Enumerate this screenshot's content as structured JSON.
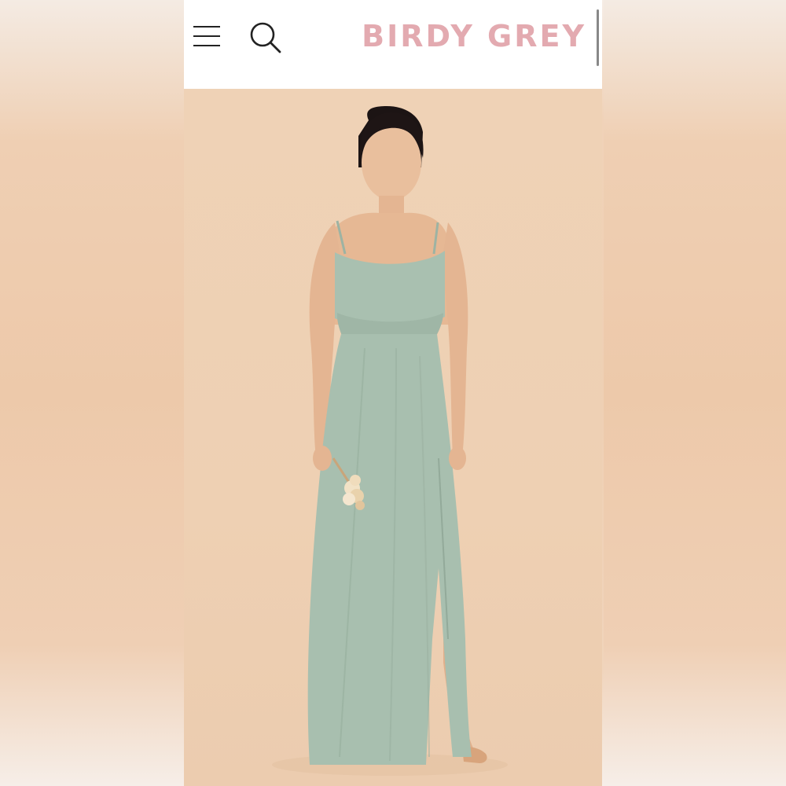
{
  "header": {
    "brand": "BIRDY GREY",
    "menu_icon": "hamburger-menu-icon",
    "search_icon": "search-icon"
  },
  "hero": {
    "image": "model-in-sage-chiffon-maxi-dress",
    "background_color": "#efd2b6",
    "dress_color": "#a8bfaf"
  },
  "colors": {
    "brand_pink": "#e3aab0",
    "header_bg": "#ffffff"
  }
}
